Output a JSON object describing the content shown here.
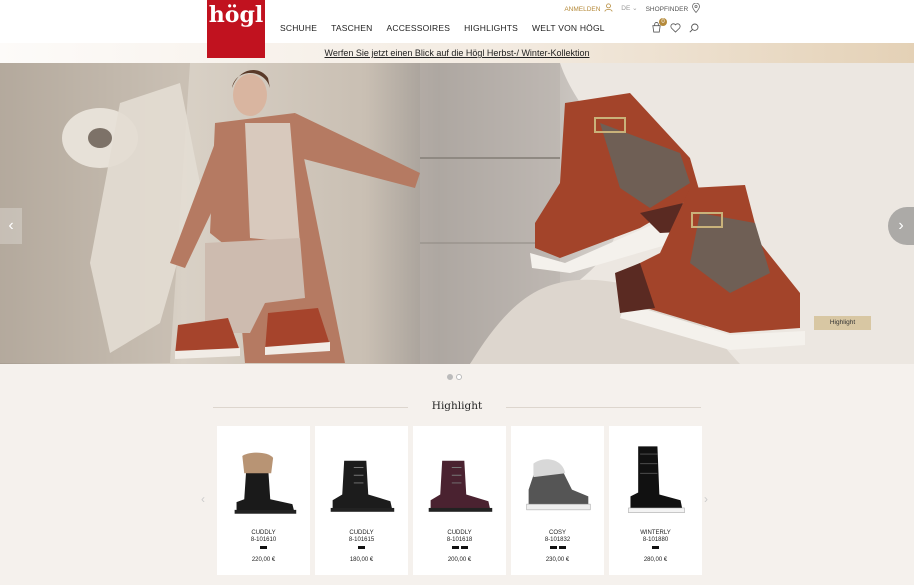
{
  "header": {
    "logo_text": "högl",
    "nav": [
      "SCHUHE",
      "TASCHEN",
      "ACCESSOIRES",
      "HIGHLIGHTS",
      "WELT VON HÖGL"
    ],
    "login": "ANMELDEN",
    "language": "DE",
    "language_chevron": "⌄",
    "shopfinder": "SHOPFINDER",
    "cart_count": "0",
    "icons": [
      "user-icon",
      "location-pin-icon",
      "cart-icon",
      "heart-icon",
      "search-icon"
    ]
  },
  "promo": {
    "text": "Werfen Sie jetzt einen Blick auf die Högl Herbst-/ Winter-Kollektion"
  },
  "hero": {
    "tag": "Highlight",
    "prev_arrow": "‹",
    "next_arrow": "›",
    "slides": 2,
    "active_slide": 1
  },
  "section": {
    "title": "Highlight",
    "prev_arrow": "‹",
    "next_arrow": "›"
  },
  "products": [
    {
      "name": "CUDDLY",
      "sku": "8-101610",
      "swatches": 1,
      "price": "220,00 €",
      "color": "#1a1a1a",
      "style": "fur-boot"
    },
    {
      "name": "CUDDLY",
      "sku": "8-101615",
      "swatches": 1,
      "price": "180,00 €",
      "color": "#1c1c1c",
      "style": "lace-boot"
    },
    {
      "name": "CUDDLY",
      "sku": "8-101618",
      "swatches": 2,
      "price": "200,00 €",
      "color": "#4a2230",
      "style": "lace-boot"
    },
    {
      "name": "COSY",
      "sku": "8-101832",
      "swatches": 2,
      "price": "230,00 €",
      "color": "#555555",
      "style": "sneaker"
    },
    {
      "name": "WINTERLY",
      "sku": "8-101880",
      "swatches": 1,
      "price": "280,00 €",
      "color": "#111111",
      "style": "snow-boot"
    }
  ],
  "colors": {
    "brand_red": "#c1121f",
    "gold": "#b58a3a",
    "background": "#f5f1ed"
  }
}
